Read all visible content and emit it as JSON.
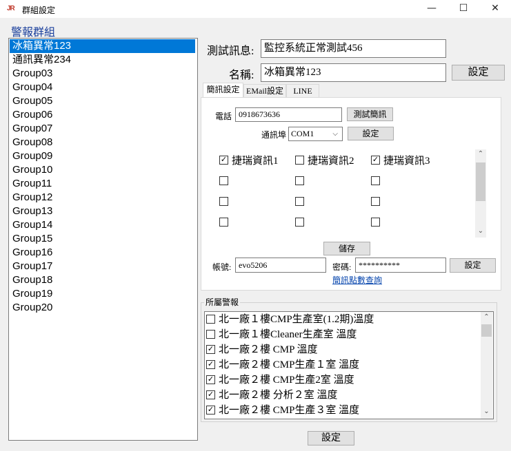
{
  "window": {
    "title": "群組設定",
    "minimize": "—",
    "maximize": "☐",
    "close": "✕"
  },
  "groups": {
    "header": "警報群組",
    "items": [
      "冰箱異常123",
      "通訊異常234",
      "Group03",
      "Group04",
      "Group05",
      "Group06",
      "Group07",
      "Group08",
      "Group09",
      "Group10",
      "Group11",
      "Group12",
      "Group13",
      "Group14",
      "Group15",
      "Group16",
      "Group17",
      "Group18",
      "Group19",
      "Group20"
    ],
    "selected_index": 0
  },
  "test_message": {
    "label": "測試訊息:",
    "value": "監控系統正常測試456"
  },
  "name": {
    "label": "名稱:",
    "value": "冰箱異常123",
    "set_button": "設定"
  },
  "tabs": [
    {
      "label": "簡訊設定",
      "active": true
    },
    {
      "label": "EMail設定",
      "active": false
    },
    {
      "label": "LINE",
      "active": false
    }
  ],
  "sms": {
    "phone_label": "電話",
    "phone_value": "0918673636",
    "test_button": "測試簡訊",
    "port_label": "通訊埠",
    "port_value": "COM1",
    "port_set_button": "設定",
    "checks": [
      [
        {
          "label": "捷瑞資訊1",
          "checked": true
        },
        {
          "label": "捷瑞資訊2",
          "checked": false
        },
        {
          "label": "捷瑞資訊3",
          "checked": true
        }
      ],
      [
        {
          "label": "",
          "checked": false
        },
        {
          "label": "",
          "checked": false
        },
        {
          "label": "",
          "checked": false
        }
      ],
      [
        {
          "label": "",
          "checked": false
        },
        {
          "label": "",
          "checked": false
        },
        {
          "label": "",
          "checked": false
        }
      ],
      [
        {
          "label": "",
          "checked": false
        },
        {
          "label": "",
          "checked": false
        },
        {
          "label": "",
          "checked": false
        }
      ]
    ],
    "save_button": "儲存",
    "account_label": "帳號:",
    "account_value": "evo5206",
    "password_label": "密碼:",
    "password_value": "**********",
    "account_set_button": "設定",
    "points_link": "簡訊點數查詢"
  },
  "alarms": {
    "legend": "所屬警報",
    "items": [
      {
        "label": "北一廠１樓CMP生產室(1.2期)溫度",
        "checked": false
      },
      {
        "label": "北一廠１樓Cleaner生產室 溫度",
        "checked": false
      },
      {
        "label": "北一廠２樓 CMP 溫度",
        "checked": true
      },
      {
        "label": "北一廠２樓 CMP生產１室 溫度",
        "checked": true
      },
      {
        "label": "北一廠２樓 CMP生產2室 溫度",
        "checked": true
      },
      {
        "label": "北一廠２樓 分析２室 溫度",
        "checked": true
      },
      {
        "label": "北一廠２樓 CMP生產３室 溫度",
        "checked": true
      }
    ],
    "set_button": "設定"
  }
}
